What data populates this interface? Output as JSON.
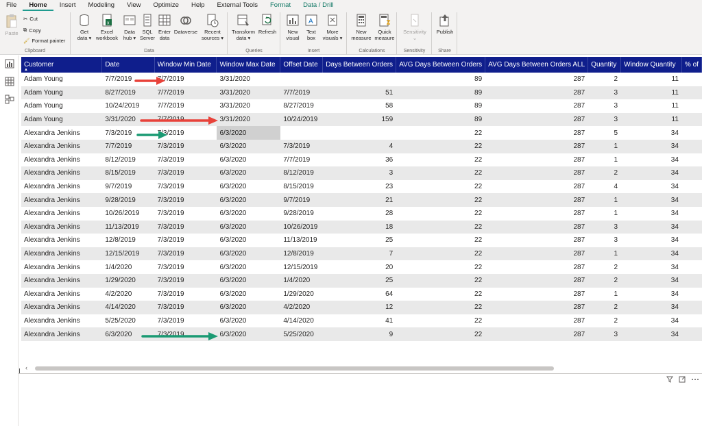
{
  "menu": {
    "tabs": [
      {
        "label": "File"
      },
      {
        "label": "Home"
      },
      {
        "label": "Insert"
      },
      {
        "label": "Modeling"
      },
      {
        "label": "View"
      },
      {
        "label": "Optimize"
      },
      {
        "label": "Help"
      },
      {
        "label": "External Tools"
      },
      {
        "label": "Format"
      },
      {
        "label": "Data / Drill"
      }
    ],
    "active": "Home"
  },
  "ribbon": {
    "clipboard": {
      "paste": "Paste",
      "cut": "Cut",
      "copy": "Copy",
      "format_painter": "Format painter",
      "label": "Clipboard"
    },
    "data": {
      "get_data": [
        "Get",
        "data ▾"
      ],
      "excel": [
        "Excel",
        "workbook"
      ],
      "data_hub": [
        "Data",
        "hub ▾"
      ],
      "sql": [
        "SQL",
        "Server"
      ],
      "enter_data": [
        "Enter",
        "data"
      ],
      "dataverse": [
        "Dataverse",
        ""
      ],
      "recent": [
        "Recent",
        "sources ▾"
      ],
      "label": "Data"
    },
    "queries": {
      "transform": [
        "Transform",
        "data ▾"
      ],
      "refresh": [
        "Refresh",
        ""
      ],
      "label": "Queries"
    },
    "insert": {
      "new_visual": [
        "New",
        "visual"
      ],
      "text_box": [
        "Text",
        "box"
      ],
      "more_visuals": [
        "More",
        "visuals ▾"
      ],
      "label": "Insert"
    },
    "calculations": {
      "new_measure": [
        "New",
        "measure"
      ],
      "quick_measure": [
        "Quick",
        "measure"
      ],
      "label": "Calculations"
    },
    "sensitivity": {
      "btn": [
        "Sensitivity",
        "⌄"
      ],
      "label": "Sensitivity"
    },
    "share": {
      "publish": [
        "Publish",
        ""
      ],
      "label": "Share"
    }
  },
  "table": {
    "columns": [
      "Customer",
      "Date",
      "Window Min Date",
      "Window Max Date",
      "Offset Date",
      "Days Between Orders",
      "AVG Days Between Orders",
      "AVG Days Between Orders ALL",
      "Quantity",
      "Window Quantity",
      "% of"
    ],
    "sort_indicator": "▲",
    "rows": [
      [
        "Adam Young",
        "7/7/2019",
        "7/7/2019",
        "3/31/2020",
        "",
        "",
        "89",
        "287",
        "2",
        "11",
        ""
      ],
      [
        "Adam Young",
        "8/27/2019",
        "7/7/2019",
        "3/31/2020",
        "7/7/2019",
        "51",
        "89",
        "287",
        "3",
        "11",
        ""
      ],
      [
        "Adam Young",
        "10/24/2019",
        "7/7/2019",
        "3/31/2020",
        "8/27/2019",
        "58",
        "89",
        "287",
        "3",
        "11",
        ""
      ],
      [
        "Adam Young",
        "3/31/2020",
        "7/7/2019",
        "3/31/2020",
        "10/24/2019",
        "159",
        "89",
        "287",
        "3",
        "11",
        ""
      ],
      [
        "Alexandra Jenkins",
        "7/3/2019",
        "7/3/2019",
        "6/3/2020",
        "",
        "",
        "22",
        "287",
        "5",
        "34",
        ""
      ],
      [
        "Alexandra Jenkins",
        "7/7/2019",
        "7/3/2019",
        "6/3/2020",
        "7/3/2019",
        "4",
        "22",
        "287",
        "1",
        "34",
        ""
      ],
      [
        "Alexandra Jenkins",
        "8/12/2019",
        "7/3/2019",
        "6/3/2020",
        "7/7/2019",
        "36",
        "22",
        "287",
        "1",
        "34",
        ""
      ],
      [
        "Alexandra Jenkins",
        "8/15/2019",
        "7/3/2019",
        "6/3/2020",
        "8/12/2019",
        "3",
        "22",
        "287",
        "2",
        "34",
        ""
      ],
      [
        "Alexandra Jenkins",
        "9/7/2019",
        "7/3/2019",
        "6/3/2020",
        "8/15/2019",
        "23",
        "22",
        "287",
        "4",
        "34",
        ""
      ],
      [
        "Alexandra Jenkins",
        "9/28/2019",
        "7/3/2019",
        "6/3/2020",
        "9/7/2019",
        "21",
        "22",
        "287",
        "1",
        "34",
        ""
      ],
      [
        "Alexandra Jenkins",
        "10/26/2019",
        "7/3/2019",
        "6/3/2020",
        "9/28/2019",
        "28",
        "22",
        "287",
        "1",
        "34",
        ""
      ],
      [
        "Alexandra Jenkins",
        "11/13/2019",
        "7/3/2019",
        "6/3/2020",
        "10/26/2019",
        "18",
        "22",
        "287",
        "3",
        "34",
        ""
      ],
      [
        "Alexandra Jenkins",
        "12/8/2019",
        "7/3/2019",
        "6/3/2020",
        "11/13/2019",
        "25",
        "22",
        "287",
        "3",
        "34",
        ""
      ],
      [
        "Alexandra Jenkins",
        "12/15/2019",
        "7/3/2019",
        "6/3/2020",
        "12/8/2019",
        "7",
        "22",
        "287",
        "1",
        "34",
        ""
      ],
      [
        "Alexandra Jenkins",
        "1/4/2020",
        "7/3/2019",
        "6/3/2020",
        "12/15/2019",
        "20",
        "22",
        "287",
        "2",
        "34",
        ""
      ],
      [
        "Alexandra Jenkins",
        "1/29/2020",
        "7/3/2019",
        "6/3/2020",
        "1/4/2020",
        "25",
        "22",
        "287",
        "2",
        "34",
        ""
      ],
      [
        "Alexandra Jenkins",
        "4/2/2020",
        "7/3/2019",
        "6/3/2020",
        "1/29/2020",
        "64",
        "22",
        "287",
        "1",
        "34",
        ""
      ],
      [
        "Alexandra Jenkins",
        "4/14/2020",
        "7/3/2019",
        "6/3/2020",
        "4/2/2020",
        "12",
        "22",
        "287",
        "2",
        "34",
        ""
      ],
      [
        "Alexandra Jenkins",
        "5/25/2020",
        "7/3/2019",
        "6/3/2020",
        "4/14/2020",
        "41",
        "22",
        "287",
        "2",
        "34",
        ""
      ],
      [
        "Alexandra Jenkins",
        "6/3/2020",
        "7/3/2019",
        "6/3/2020",
        "5/25/2020",
        "9",
        "22",
        "287",
        "3",
        "34",
        ""
      ]
    ],
    "selected_cell": {
      "row": 4,
      "col": 3
    }
  },
  "colors": {
    "header_bg": "#0f1e8c",
    "arrow_red": "#e8423a",
    "arrow_green": "#1a9a73",
    "accent_tab": "#1f9b8f"
  },
  "visual_icons": [
    "filter-icon",
    "focus-mode-icon",
    "more-options-icon"
  ]
}
